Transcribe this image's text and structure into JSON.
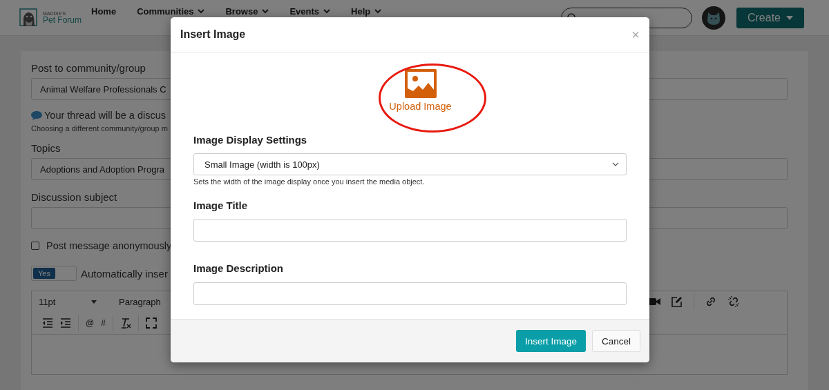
{
  "header": {
    "logo": {
      "tagline": "MADDIE'S",
      "name": "Pet Forum"
    },
    "nav": [
      {
        "label": "Home",
        "dropdown": false
      },
      {
        "label": "Communities",
        "dropdown": true
      },
      {
        "label": "Browse",
        "dropdown": true
      },
      {
        "label": "Events",
        "dropdown": true
      },
      {
        "label": "Help",
        "dropdown": true
      }
    ],
    "create_button": "Create"
  },
  "form": {
    "community": {
      "label": "Post to community/group",
      "value": "Animal Welfare Professionals C"
    },
    "notice": "Your thread will be a discus",
    "notice_help": "Choosing a different community/group m",
    "topics": {
      "label": "Topics",
      "value": "Adoptions and Adoption Progra"
    },
    "subject": {
      "label": "Discussion subject"
    },
    "anonymous": {
      "label": "Post message anonymously",
      "checked": false
    },
    "auto_insert": {
      "toggle": "Yes",
      "on": true,
      "label": "Automatically inser"
    },
    "editor": {
      "font_size": "11pt",
      "block_format": "Paragraph",
      "mention": "@",
      "hashtag": "#"
    }
  },
  "modal": {
    "title": "Insert Image",
    "close": "×",
    "upload": "Upload Image",
    "highlighted": true,
    "display_label": "Image Display Settings",
    "display_value": "Small Image (width is 100px)",
    "display_help": "Sets the width of the image display once you insert the media object.",
    "title_label": "Image Title",
    "description_label": "Image Description",
    "buttons": [
      {
        "label": "Insert Image",
        "kind": "primary"
      },
      {
        "label": "Cancel",
        "kind": "secondary"
      }
    ]
  }
}
